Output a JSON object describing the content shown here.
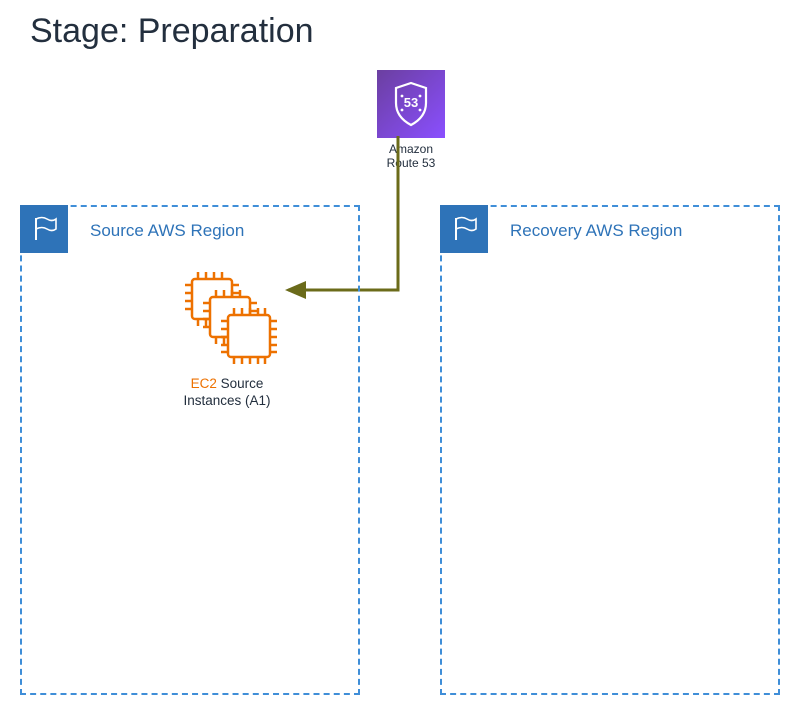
{
  "title": "Stage: Preparation",
  "route53": {
    "label_line1": "Amazon",
    "label_line2": "Route 53",
    "badge_number": "53"
  },
  "regions": {
    "source": {
      "title": "Source AWS Region"
    },
    "recovery": {
      "title": "Recovery AWS Region"
    }
  },
  "ec2": {
    "prefix": "EC2",
    "label_line1_rest": " Source",
    "label_line2": "Instances (A1)"
  },
  "colors": {
    "accent_blue": "#2e73b8",
    "orange": "#ed7100",
    "olive": "#6b6b1a",
    "purple": "#8a4fff"
  }
}
